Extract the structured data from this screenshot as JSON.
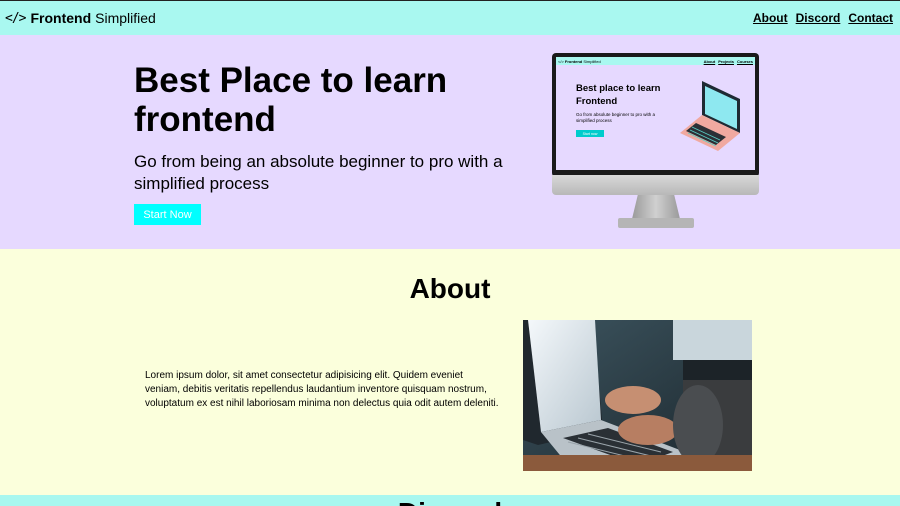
{
  "nav": {
    "logo_icon": "</>",
    "logo_bold": "Frontend",
    "logo_light": "Simplified",
    "links": [
      "About",
      "Discord",
      "Contact"
    ]
  },
  "hero": {
    "title": "Best Place to learn frontend",
    "subtitle": "Go from being an absolute beginner to pro with a simplified process",
    "button": "Start Now",
    "mockup": {
      "logo_bold": "Frontend",
      "logo_light": "Simplified",
      "links": [
        "About",
        "Projects",
        "Courses"
      ],
      "title": "Best place to learn Frontend",
      "subtitle": "Go from absolute beginner to pro with a simplified process",
      "button": "Start now"
    }
  },
  "about": {
    "title": "About",
    "body": "Lorem ipsum dolor, sit amet consectetur adipisicing elit. Quidem eveniet veniam, debitis veritatis repellendus laudantium inventore quisquam nostrum, voluptatum ex est nihil laboriosam minima non delectus quia odit autem deleniti."
  },
  "discord": {
    "title": "Discord"
  },
  "colors": {
    "nav_bg": "#a9f8f0",
    "hero_bg": "#e6d9ff",
    "about_bg": "#fbffdc",
    "accent": "#00ffff"
  }
}
